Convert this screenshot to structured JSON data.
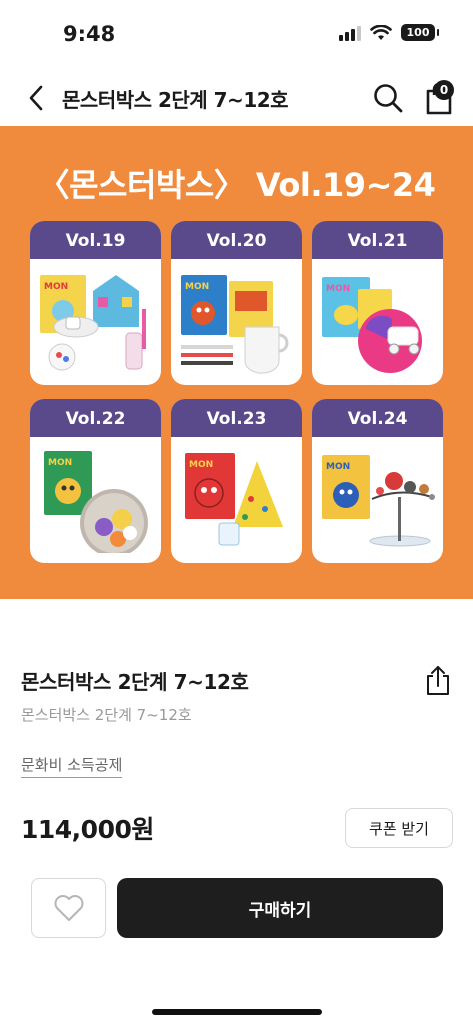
{
  "status_bar": {
    "time": "9:48",
    "battery": "100",
    "icons": [
      "signal-icon",
      "wifi-icon",
      "battery-icon"
    ]
  },
  "header": {
    "title": "몬스터박스 2단계 7~12호",
    "cart_count": "0",
    "icons": [
      "back-chevron-icon",
      "search-icon",
      "shopping-bag-icon"
    ]
  },
  "banner": {
    "title": "〈몬스터박스〉 Vol.19~24",
    "background_color": "#f08a3c",
    "tab_color": "#5a4a8c",
    "volumes": [
      {
        "label": "Vol.19"
      },
      {
        "label": "Vol.20"
      },
      {
        "label": "Vol.21"
      },
      {
        "label": "Vol.22"
      },
      {
        "label": "Vol.23"
      },
      {
        "label": "Vol.24"
      }
    ]
  },
  "product": {
    "title": "몬스터박스 2단계 7~12호",
    "subtitle": "몬스터박스 2단계 7~12호",
    "tag": "문화비 소득공제",
    "price": "114,000원",
    "coupon_label": "쿠폰 받기"
  },
  "actions": {
    "buy_label": "구매하기",
    "icons": [
      "heart-icon",
      "share-icon"
    ]
  }
}
